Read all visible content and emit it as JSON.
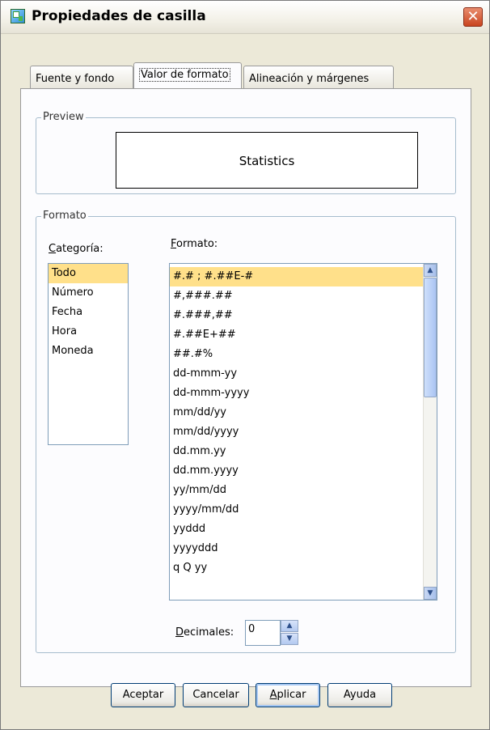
{
  "window": {
    "title": "Propiedades de casilla",
    "close_glyph": "✕"
  },
  "tabs": [
    {
      "label": "Fuente y fondo",
      "active": false
    },
    {
      "label": "Valor de formato",
      "active": true
    },
    {
      "label": "Alineación y márgenes",
      "active": false
    }
  ],
  "preview": {
    "legend": "Preview",
    "text": "Statistics"
  },
  "format_group": {
    "legend": "Formato",
    "category_label": "Categoría:",
    "category_mnemonic": "C",
    "category_rest": "ategoría:",
    "format_label_mnemonic": "F",
    "format_label_rest": "ormato:",
    "categories": [
      "Todo",
      "Número",
      "Fecha",
      "Hora",
      "Moneda"
    ],
    "selected_category": "Todo",
    "formats": [
      "#.# ; #.##E-#",
      "#,###.##",
      "#.###,##",
      "#.##E+##",
      "##.#%",
      "dd-mmm-yy",
      "dd-mmm-yyyy",
      "mm/dd/yy",
      "mm/dd/yyyy",
      "dd.mm.yy",
      "dd.mm.yyyy",
      "yy/mm/dd",
      "yyyy/mm/dd",
      "yyddd",
      "yyyyddd",
      "q Q yy"
    ],
    "selected_format": "#.# ; #.##E-#",
    "decimals_mnemonic": "D",
    "decimals_rest": "ecimales:",
    "decimals_value": "0"
  },
  "buttons": {
    "ok": "Aceptar",
    "cancel": "Cancelar",
    "apply_mnemonic": "A",
    "apply_rest": "plicar",
    "help": "Ayuda"
  },
  "icons": {
    "app": "cell-properties-icon",
    "scroll_up": "▲",
    "scroll_down": "▼"
  }
}
